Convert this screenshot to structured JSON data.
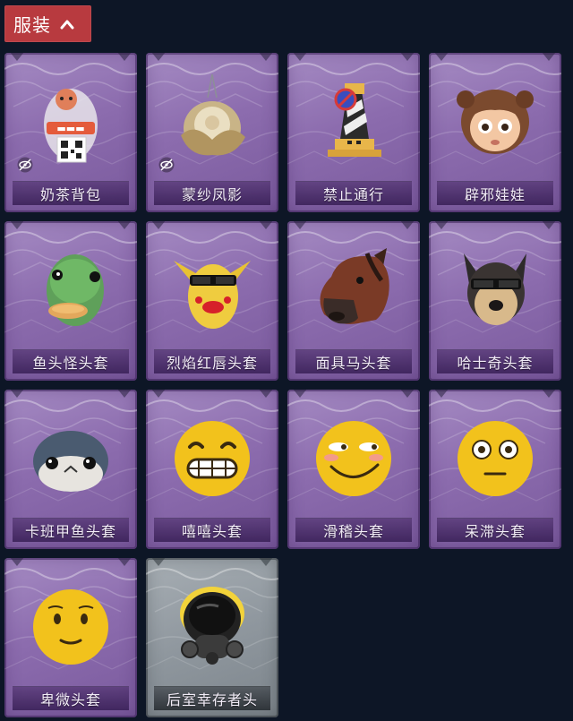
{
  "header": {
    "label": "服装",
    "icon": "chevron-up-icon",
    "color": "#b83a3f"
  },
  "items": [
    {
      "name": "奶茶背包",
      "icon": "milk-tea-backpack-icon",
      "hidden": true,
      "frame": "purple"
    },
    {
      "name": "蒙纱凤影",
      "icon": "phoenix-pendant-icon",
      "hidden": true,
      "frame": "purple"
    },
    {
      "name": "禁止通行",
      "icon": "traffic-cone-icon",
      "hidden": false,
      "frame": "purple"
    },
    {
      "name": "辟邪娃娃",
      "icon": "doll-head-icon",
      "hidden": false,
      "frame": "purple"
    },
    {
      "name": "鱼头怪头套",
      "icon": "fish-head-mask-icon",
      "hidden": false,
      "frame": "purple"
    },
    {
      "name": "烈焰红唇头套",
      "icon": "red-lips-mask-icon",
      "hidden": false,
      "frame": "purple"
    },
    {
      "name": "面具马头套",
      "icon": "horse-mask-icon",
      "hidden": false,
      "frame": "purple"
    },
    {
      "name": "哈士奇头套",
      "icon": "husky-mask-icon",
      "hidden": false,
      "frame": "purple"
    },
    {
      "name": "卡班甲鱼头套",
      "icon": "fish-mask-icon",
      "hidden": false,
      "frame": "purple"
    },
    {
      "name": "嘻嘻头套",
      "icon": "grin-emoji-icon",
      "hidden": false,
      "frame": "purple"
    },
    {
      "name": "滑稽头套",
      "icon": "funny-emoji-icon",
      "hidden": false,
      "frame": "purple"
    },
    {
      "name": "呆滞头套",
      "icon": "dazed-emoji-icon",
      "hidden": false,
      "frame": "purple"
    },
    {
      "name": "卑微头套",
      "icon": "humble-emoji-icon",
      "hidden": false,
      "frame": "purple"
    },
    {
      "name": "后室幸存者头",
      "icon": "gas-mask-helmet-icon",
      "hidden": false,
      "frame": "grey"
    }
  ],
  "icons": {
    "hidden": "eye-slash-icon"
  }
}
